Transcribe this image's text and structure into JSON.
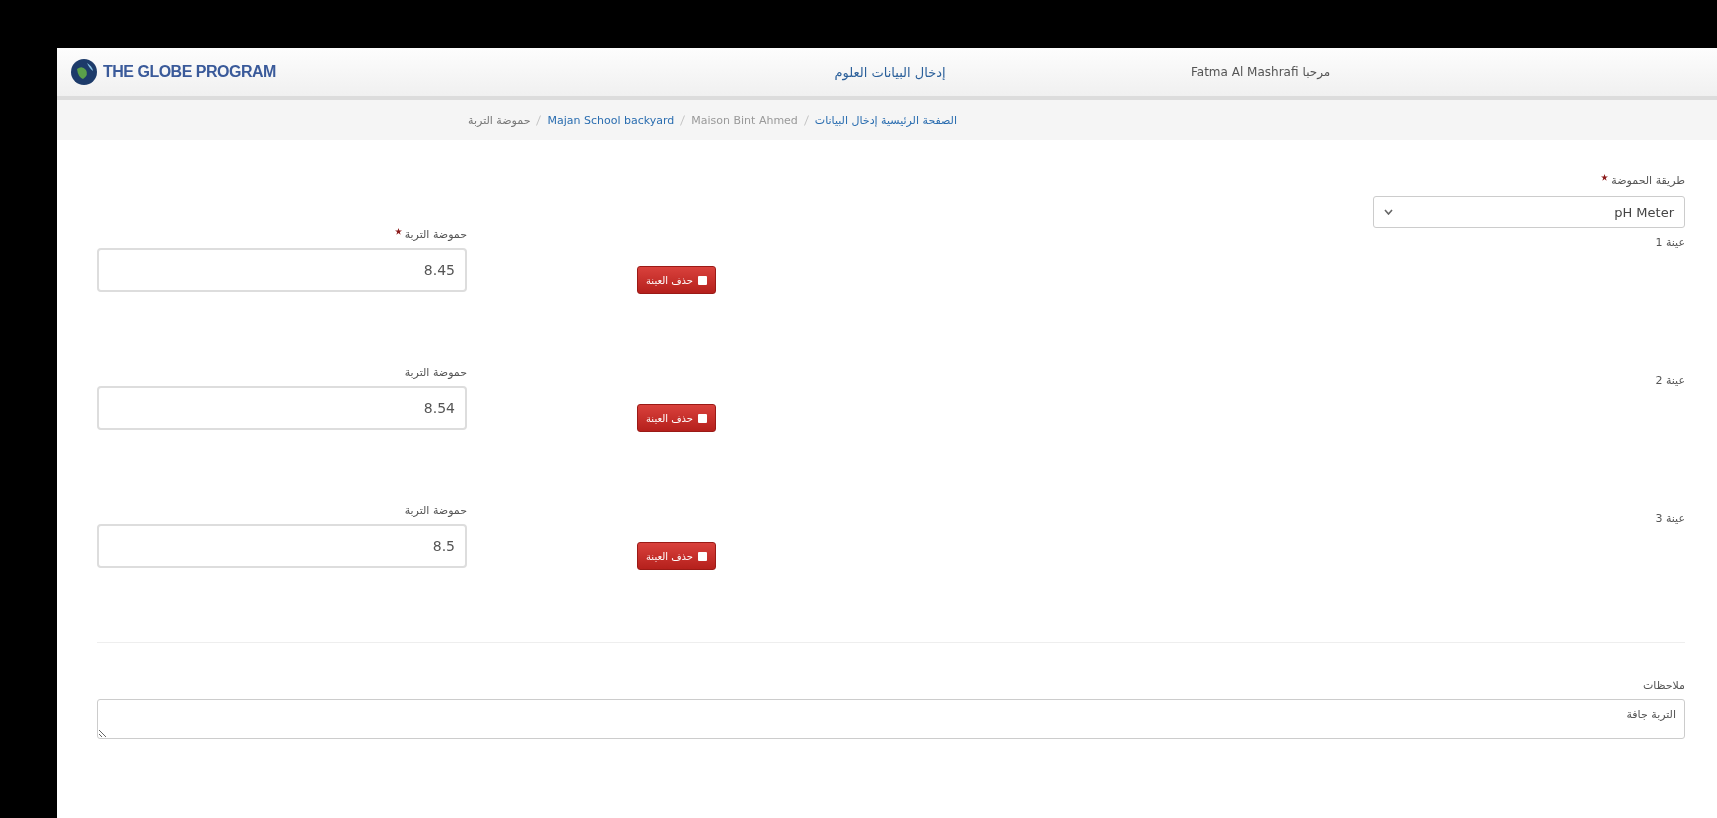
{
  "header": {
    "logo_text": "THE GLOBE PROGRAM",
    "title": "إدخال البيانات العلوم",
    "greeting": "مرحبا",
    "user": "Fatma Al Mashrafi"
  },
  "breadcrumb": [
    {
      "label": "الصفحة الرئيسية إدخال البيانات",
      "kind": "link"
    },
    {
      "label": "Maison Bint Ahmed",
      "kind": "muted"
    },
    {
      "label": "Majan School backyard",
      "kind": "link"
    },
    {
      "label": "حموضة التربة",
      "kind": "current"
    }
  ],
  "method": {
    "label": "طريقة الحموضة",
    "required": true,
    "value": "pH Meter"
  },
  "samples": [
    {
      "title": "عينة 1",
      "field_label": "حموضة التربة",
      "required": true,
      "value": "8.45",
      "button": "حذف العينة"
    },
    {
      "title": "عينة 2",
      "field_label": "حموضة التربة",
      "required": false,
      "value": "8.54",
      "button": "حذف العينة"
    },
    {
      "title": "عينة 3",
      "field_label": "حموضة التربة",
      "required": false,
      "value": "8.5",
      "button": "حذف العينة"
    }
  ],
  "comments": {
    "label": "ملاحظات",
    "value": "التربة جافة"
  }
}
